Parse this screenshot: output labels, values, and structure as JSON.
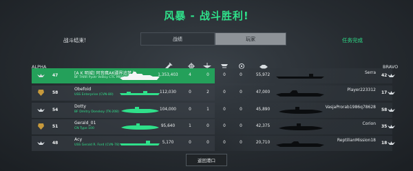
{
  "header": {
    "title": "风暴 - 战斗胜利!"
  },
  "status": {
    "left": "战斗结束!",
    "right": "任务完成"
  },
  "tabs": [
    {
      "label": "战绩",
      "active": false
    },
    {
      "label": "玩家",
      "active": true
    }
  ],
  "teams": {
    "left": "ALPHA",
    "right": "BRAVO"
  },
  "columns": [
    "damage-icon",
    "kills-icon",
    "plane-kills-icon",
    "defense-icon",
    "capture-icon",
    "score-icon"
  ],
  "rows": [
    {
      "level": "47",
      "name": "[A K 明城] 阿音鹰AK疆界追梦人",
      "ship": "BF TARR Pyotr Velikiy CTC MISSION 2014-13",
      "damage": "1,353,403",
      "kills": "4",
      "plane_kills": "0",
      "defense": "0",
      "capture": "0",
      "score": "55,972",
      "enemy_name": "Serra",
      "enemy_level": "42",
      "highlight": true
    },
    {
      "level": "58",
      "name": "Obefoid",
      "ship": "USS Enterprise (CVN-80)",
      "damage": "112,030",
      "kills": "0",
      "plane_kills": "2",
      "defense": "0",
      "capture": "0",
      "score": "47,000",
      "enemy_name": "Player223312",
      "enemy_level": "17",
      "highlight": false
    },
    {
      "level": "54",
      "name": "Dotty",
      "ship": "BF Dmitry Donskoy (TK-208)",
      "damage": "104,000",
      "kills": "0",
      "plane_kills": "1",
      "defense": "0",
      "capture": "0",
      "score": "45,890",
      "enemy_name": "VasjaProrab1986q78628",
      "enemy_level": "58",
      "highlight": false
    },
    {
      "level": "51",
      "name": "Gerald_01",
      "ship": "CN Type 100",
      "damage": "95,640",
      "kills": "1",
      "plane_kills": "0",
      "defense": "0",
      "capture": "0",
      "score": "42,375",
      "enemy_name": "Corion",
      "enemy_level": "35",
      "highlight": false
    },
    {
      "level": "48",
      "name": "Acy",
      "ship": "USS Gerald R. Ford (CVN-78)",
      "damage": "5,170",
      "kills": "0",
      "plane_kills": "0",
      "defense": "0",
      "capture": "0",
      "score": "20,710",
      "enemy_name": "ReptilianMission18",
      "enemy_level": "18",
      "highlight": false
    }
  ],
  "footer": {
    "return_label": "返回港口"
  },
  "colors": {
    "accent": "#2fe08a",
    "highlight_row": "#24a05a"
  }
}
